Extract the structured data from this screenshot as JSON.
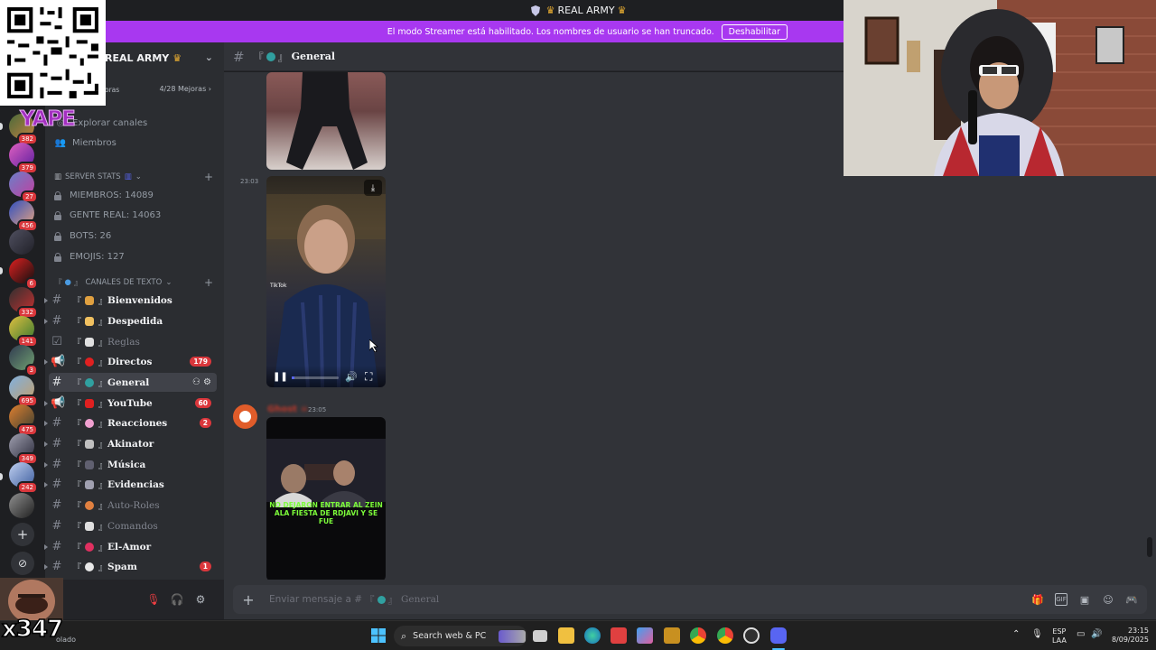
{
  "titlebar": {
    "title": "REAL ARMY"
  },
  "streamer": {
    "message": "El modo Streamer está habilitado. Los nombres de usuario se han truncado.",
    "button": "Deshabilitar"
  },
  "server": {
    "name": "REAL ARMY",
    "boost_label": "oras",
    "boost_count": "4/28 Mejoras"
  },
  "nav": {
    "explore": "Explorar canales",
    "members": "Miembros"
  },
  "rail_badges": [
    "382",
    "379",
    "27",
    "456",
    "6",
    "332",
    "141",
    "3",
    "695",
    "475",
    "349",
    "242"
  ],
  "stats_category": "SERVER STATS",
  "stats": [
    "MIEMBROS: 14089",
    "GENTE REAL: 14063",
    "BOTS: 26",
    "EMOJIS: 127"
  ],
  "text_category": "CANALES DE TEXTO",
  "channels": [
    {
      "name": "Bienvenidos",
      "badge": ""
    },
    {
      "name": "Despedida",
      "badge": ""
    },
    {
      "name": "Reglas",
      "badge": ""
    },
    {
      "name": "Directos",
      "badge": "179"
    },
    {
      "name": "General",
      "badge": ""
    },
    {
      "name": "YouTube",
      "badge": "60"
    },
    {
      "name": "Reacciones",
      "badge": "2"
    },
    {
      "name": "Akinator",
      "badge": ""
    },
    {
      "name": "Música",
      "badge": ""
    },
    {
      "name": "Evidencias",
      "badge": ""
    },
    {
      "name": "Auto-Roles",
      "badge": ""
    },
    {
      "name": "Comandos",
      "badge": ""
    },
    {
      "name": "El-Amor",
      "badge": ""
    },
    {
      "name": "Spam",
      "badge": "1"
    }
  ],
  "chat": {
    "channel": "General",
    "msg1_time": "23:03",
    "msg2_author": "Ghost",
    "msg2_time": "23:05",
    "video_caption": [
      "NO DEJARON ENTRAR AL ZEIN",
      "ALA FIESTA DE RDJAVI Y SE FUE"
    ],
    "tiktok_label": "TikTok"
  },
  "composer": {
    "placeholder_prefix": "Enviar mensaje a #",
    "channel": "General"
  },
  "taskbar": {
    "search": "Search web & PC",
    "lang_top": "ESP",
    "lang_bottom": "LAA",
    "time": "23:15",
    "date": "8/09/2025"
  },
  "overlays": {
    "yape": "YAPE",
    "counter": "x347",
    "cam_label": "olado"
  },
  "colors": {
    "accent": "#a838f0",
    "badge": "#da373c",
    "yape": "#a42fc1"
  }
}
